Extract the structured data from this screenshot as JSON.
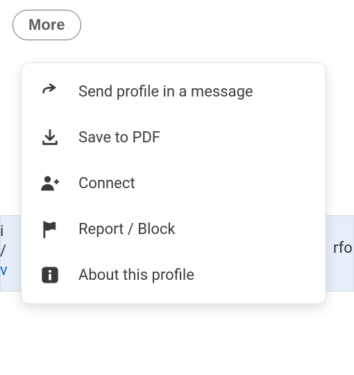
{
  "more_button": {
    "label": "More"
  },
  "menu": {
    "items": [
      {
        "id": "send-profile",
        "icon": "share-arrow",
        "label": "Send profile in a message"
      },
      {
        "id": "save-pdf",
        "icon": "download",
        "label": "Save to PDF"
      },
      {
        "id": "connect",
        "icon": "person-plus",
        "label": "Connect"
      },
      {
        "id": "report-block",
        "icon": "flag",
        "label": "Report / Block"
      },
      {
        "id": "about-profile",
        "icon": "info",
        "label": "About this profile"
      }
    ]
  },
  "background": {
    "right_fragment": "rfo"
  }
}
